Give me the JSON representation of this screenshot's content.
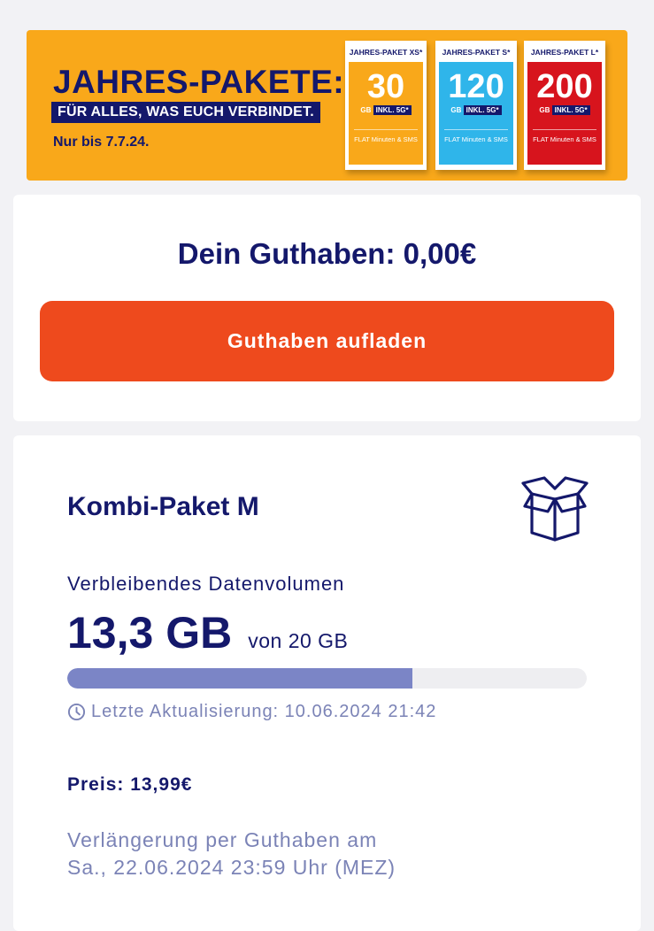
{
  "banner": {
    "title": "JAHRES-PAKETE:",
    "subtitle": "FÜR ALLES, WAS EUCH VERBINDET.",
    "date_note": "Nur bis 7.7.24.",
    "packages": [
      {
        "name": "JAHRES-PAKET XS*",
        "volume": "30",
        "unit": "GB",
        "tag": "INKL. 5G*",
        "flat": "FLAT Minuten & SMS",
        "color": "#f9a81a"
      },
      {
        "name": "JAHRES-PAKET S*",
        "volume": "120",
        "unit": "GB",
        "tag": "INKL. 5G*",
        "flat": "FLAT Minuten & SMS",
        "color": "#2fb5ea"
      },
      {
        "name": "JAHRES-PAKET L*",
        "volume": "200",
        "unit": "GB",
        "tag": "INKL. 5G*",
        "flat": "FLAT Minuten & SMS",
        "color": "#d7141d"
      }
    ]
  },
  "balance": {
    "text": "Dein Guthaben: 0,00€",
    "topup_label": "Guthaben aufladen",
    "button_color": "#ee4a1d"
  },
  "package": {
    "title": "Kombi-Paket M",
    "icon": "box-icon",
    "data_label": "Verbleibendes Datenvolumen",
    "remaining": "13,3 GB",
    "total": "von 20 GB",
    "progress_fraction": 0.665,
    "update_icon": "clock-icon",
    "last_update": "Letzte Aktualisierung: 10.06.2024 21:42",
    "price": "Preis: 13,99€",
    "renewal_line1": "Verlängerung per Guthaben am",
    "renewal_line2": "Sa., 22.06.2024 23:59 Uhr (MEZ)"
  },
  "colors": {
    "brand_navy": "#14186b",
    "progress_fill": "#7b85c6",
    "muted_text": "#7b83b6"
  }
}
